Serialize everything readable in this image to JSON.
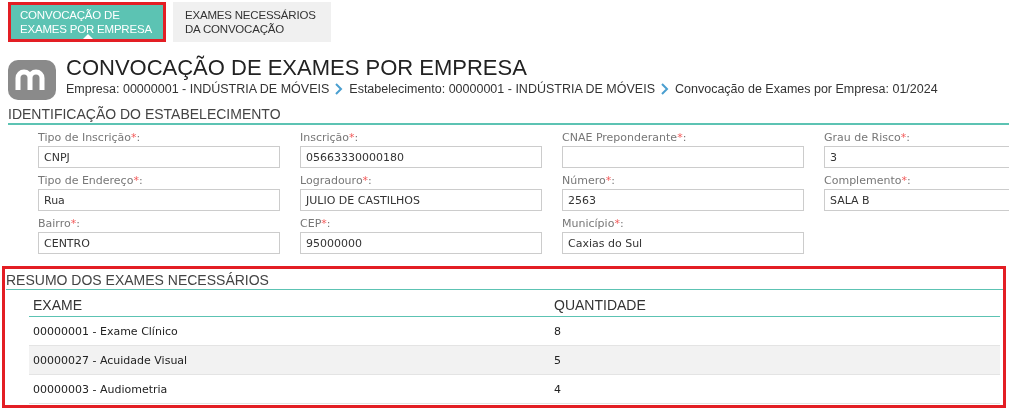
{
  "tabs": [
    {
      "label": "CONVOCAÇÃO DE EXAMES POR EMPRESA",
      "selected": true,
      "highlighted": true
    },
    {
      "label": "EXAMES NECESSÁRIOS DA CONVOCAÇÃO",
      "selected": false,
      "highlighted": false
    }
  ],
  "header": {
    "title": "CONVOCAÇÃO DE EXAMES POR EMPRESA",
    "breadcrumb": [
      "Empresa: 00000001 - INDÚSTRIA DE MÓVEIS",
      "Estabelecimento: 00000001 - INDÚSTRIA DE MÓVEIS",
      "Convocação de Exames por Empresa: 01/2024"
    ]
  },
  "establishment": {
    "title": "IDENTIFICAÇÃO DO ESTABELECIMENTO",
    "fields": [
      {
        "label": "Tipo de Inscrição",
        "required_mark": "*",
        "suffix": ":",
        "value": "CNPJ"
      },
      {
        "label": "Inscrição",
        "required_mark": "*",
        "suffix": ":",
        "value": "05663330000180"
      },
      {
        "label": "CNAE Preponderante",
        "required_mark": "*",
        "suffix": ":"
      },
      {
        "label": "Grau de Risco",
        "required_mark": "*",
        "suffix": ":",
        "value": "3"
      },
      {
        "label": "Tipo de Endereço",
        "required_mark": "*",
        "suffix": ":",
        "value": "Rua"
      },
      {
        "label": "Logradouro",
        "required_mark": "*",
        "suffix": ":",
        "value": "JULIO DE CASTILHOS"
      },
      {
        "label": "Número",
        "required_mark": "*",
        "suffix": ":",
        "value": "2563"
      },
      {
        "label": "Complemento",
        "required_mark": "*",
        "suffix": ":",
        "value": "SALA B"
      },
      {
        "label": "Bairro",
        "required_mark": "*",
        "suffix": ":",
        "value": "CENTRO"
      },
      {
        "label": "CEP",
        "required_mark": "*",
        "suffix": ":",
        "value": "95000000"
      },
      {
        "label": "Município",
        "required_mark": "*",
        "suffix": ":",
        "value": "Caxias do Sul"
      }
    ]
  },
  "summary": {
    "title": "RESUMO DOS EXAMES NECESSÁRIOS",
    "highlighted": true,
    "table": {
      "columns": [
        "EXAME",
        "QUANTIDADE"
      ],
      "rows": [
        [
          "00000001 - Exame Clínico",
          "8"
        ],
        [
          "00000027 - Acuidade Visual",
          "5"
        ],
        [
          "00000003 - Audiometria",
          "4"
        ]
      ]
    }
  }
}
